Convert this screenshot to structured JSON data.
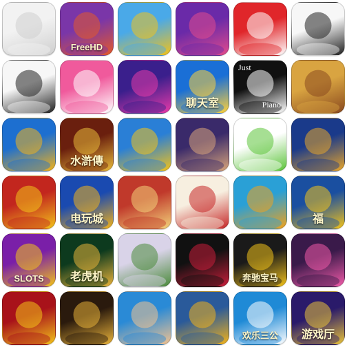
{
  "title": "",
  "apps": [
    {
      "id": "sketch-massage",
      "label": "",
      "colors": [
        "#f2f2f2",
        "#cfcfcf"
      ]
    },
    {
      "id": "guitar-free-hd",
      "label": "FreeHD",
      "colors": [
        "#7a36a8",
        "#e4592a"
      ]
    },
    {
      "id": "yellow-creature-piano",
      "label": "",
      "colors": [
        "#4aa9e8",
        "#f2c21a"
      ]
    },
    {
      "id": "headphone-girl-purple",
      "label": "",
      "colors": [
        "#6a2aa8",
        "#e24a8c"
      ]
    },
    {
      "id": "cups-red",
      "label": "",
      "colors": [
        "#e0262a",
        "#ffffff"
      ]
    },
    {
      "id": "rage-face-smirk",
      "label": "",
      "colors": [
        "#f7f7f7",
        "#222222"
      ]
    },
    {
      "id": "rage-face-skeptical",
      "label": "",
      "colors": [
        "#f7f7f7",
        "#222222"
      ]
    },
    {
      "id": "headphone-girl-pink",
      "label": "",
      "colors": [
        "#f05a9c",
        "#ffffff"
      ]
    },
    {
      "id": "piano-tiles-note",
      "label": "",
      "colors": [
        "#3a1f8c",
        "#e83aa8"
      ]
    },
    {
      "id": "chat-room-2",
      "label": "聊天室",
      "colors": [
        "#1a6fd6",
        "#ffd23a"
      ]
    },
    {
      "id": "just-piano",
      "label": "Just",
      "label2": "Piano",
      "colors": [
        "#111111",
        "#ffffff"
      ]
    },
    {
      "id": "grin-face",
      "label": "",
      "colors": [
        "#d9a441",
        "#8a4a1f"
      ]
    },
    {
      "id": "golden-fish",
      "label": "",
      "colors": [
        "#1d6fd0",
        "#f2b21a"
      ]
    },
    {
      "id": "water-margin",
      "label": "水滸傳",
      "colors": [
        "#6a1f0e",
        "#e8b93a"
      ]
    },
    {
      "id": "lion-cards-hat",
      "label": "",
      "colors": [
        "#2a7fd6",
        "#f2c21a"
      ]
    },
    {
      "id": "lady-cards",
      "label": "",
      "colors": [
        "#3a2a6a",
        "#d8a47a"
      ]
    },
    {
      "id": "green-smile-cards",
      "label": "",
      "colors": [
        "#ffffff",
        "#5cc43a"
      ]
    },
    {
      "id": "lion-casino",
      "label": "",
      "colors": [
        "#1a3a8a",
        "#e8a52a"
      ]
    },
    {
      "id": "coin-pusher",
      "label": "",
      "colors": [
        "#c2261e",
        "#f2c21a"
      ]
    },
    {
      "id": "lion-arcade",
      "label": "电玩城",
      "colors": [
        "#1a4ab0",
        "#f2b21a"
      ]
    },
    {
      "id": "king-cards",
      "label": "",
      "colors": [
        "#c0392b",
        "#f2d27a"
      ]
    },
    {
      "id": "cards-calligraphy",
      "label": "",
      "colors": [
        "#f7efe0",
        "#c62828"
      ]
    },
    {
      "id": "animal-party",
      "label": "",
      "colors": [
        "#2aa0d6",
        "#f2a21a"
      ]
    },
    {
      "id": "fortune-cards",
      "label": "福",
      "colors": [
        "#1a4fa0",
        "#f2c21a"
      ]
    },
    {
      "id": "slots-777",
      "label": "SLOTS",
      "colors": [
        "#7a1fa8",
        "#f2c21a"
      ]
    },
    {
      "id": "tiger-machine",
      "label": "老虎机",
      "colors": [
        "#0d3a1e",
        "#e8b23a"
      ]
    },
    {
      "id": "mahjong-girl-blonde",
      "label": "",
      "colors": [
        "#d9d3e8",
        "#4a8a3a"
      ]
    },
    {
      "id": "mahjong-girl-dark",
      "label": "",
      "colors": [
        "#111111",
        "#c81e3a"
      ]
    },
    {
      "id": "benz-bmw",
      "label": "奔驰宝马",
      "colors": [
        "#1a1a1a",
        "#f2c21a"
      ]
    },
    {
      "id": "pink-hair-girl",
      "label": "",
      "colors": [
        "#3a1a4a",
        "#f05aa8"
      ]
    },
    {
      "id": "red-777",
      "label": "",
      "colors": [
        "#a8121a",
        "#f2c21a"
      ]
    },
    {
      "id": "beibei-brown",
      "label": "",
      "colors": [
        "#2a1a0d",
        "#e8b23a"
      ]
    },
    {
      "id": "cartoon-man-cards",
      "label": "",
      "colors": [
        "#2a8ad6",
        "#f2c290"
      ]
    },
    {
      "id": "cow-cards",
      "label": "",
      "colors": [
        "#2a5a9a",
        "#f2b21a"
      ]
    },
    {
      "id": "happy-three-cards",
      "label": "欢乐三公",
      "colors": [
        "#1f8ad6",
        "#ffffff"
      ]
    },
    {
      "id": "game-hall",
      "label": "游戏厅",
      "colors": [
        "#2a1a6a",
        "#e8c23a"
      ]
    }
  ]
}
